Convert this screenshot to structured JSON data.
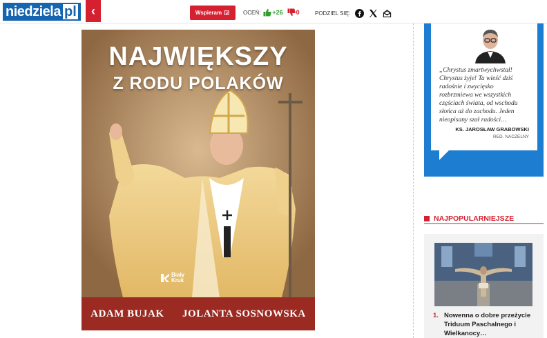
{
  "header": {
    "logo_main": "niedziela",
    "logo_suffix": "pl",
    "back_icon": "chevron-left-icon",
    "support_label": "Wspieram",
    "rate_label": "OCEŃ:",
    "upvotes": "+26",
    "downvotes": "0",
    "share_label": "PODZIEL SIĘ:",
    "share_icons": [
      "facebook-icon",
      "x-icon",
      "email-icon"
    ]
  },
  "book": {
    "title_line1": "NAJWIĘKSZY",
    "title_line2": "Z RODU POLAKÓW",
    "author1": "ADAM BUJAK",
    "author2": "JOLANTA SOSNOWSKA",
    "publisher_line1": "Biały",
    "publisher_line2": "Kruk"
  },
  "editor": {
    "quote": "„Chrystus zmartwychwstał! Chrystus żyje! Ta wieść dziś radośnie i zwycięsko rozbrzmiewa we wszystkich częściach świata, od wschodu słońca aż do zachodu. Jeden nieopisany szał radości…",
    "name": "KS. JAROSŁAW GRABOWSKI",
    "role": "RED. NACZELNY"
  },
  "popular": {
    "heading": "NAJPOPULARNIEJSZE",
    "items": [
      {
        "number": "1.",
        "title": "Nowenna o dobre przeżycie Triduum Paschalnego i Wielkanocy…"
      }
    ]
  },
  "colors": {
    "brand_blue": "#1565b0",
    "accent_red": "#d4202f",
    "editor_blue": "#1d7dd1"
  }
}
